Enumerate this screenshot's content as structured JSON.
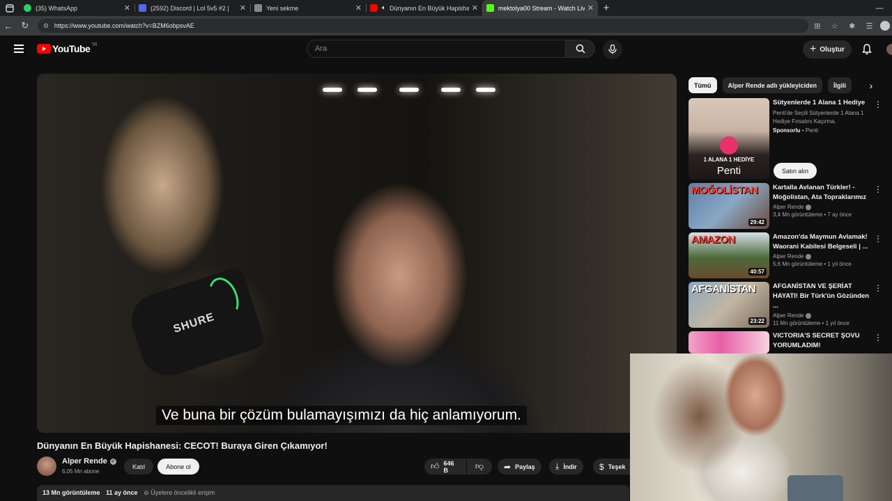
{
  "browser": {
    "tabs": [
      {
        "label": "(35) WhatsApp",
        "color": "#25d366"
      },
      {
        "label": "(2592) Discord | Lol 5v5 #2 |",
        "color": "#5865f2"
      },
      {
        "label": "Yeni sekme",
        "color": "#888888"
      },
      {
        "label": "Dünyanın En Büyük Hapisha",
        "color": "#ff0000"
      },
      {
        "label": "mektolya00 Stream - Watch Live",
        "color": "#53fc18"
      }
    ],
    "url": "https://www.youtube.com/watch?v=BZM6obpsvAE"
  },
  "header": {
    "logo": "YouTube",
    "country": "TR",
    "search_placeholder": "Ara",
    "create_label": "Oluştur"
  },
  "video": {
    "caption": "Ve buna bir çözüm bulamayışımızı da hiç anlamıyorum.",
    "mic_brand": "SHURE",
    "title": "Dünyanın En Büyük Hapishanesi: CECOT! Buraya Giren Çıkamıyor!",
    "channel": "Alper Rende",
    "subscribers": "6,05 Mn abone",
    "join_label": "Katıl",
    "subscribe_label": "Abone ol",
    "likes": "646 B",
    "share_label": "Paylaş",
    "download_label": "İndir",
    "thanks_label": "Teşek",
    "views": "13 Mn görüntüleme",
    "age": "11 ay önce",
    "members": "Üyelere öncelikli erişim"
  },
  "sidebar": {
    "chips": [
      "Tümü",
      "Alper Rende adlı yükleyiciden",
      "İlgili"
    ],
    "ad": {
      "title": "Sütyenlerde 1 Alana 1 Hediye",
      "description": "Penti'de Seçili Sütyenlerde 1 Alana 1 Hediye Fırsatını Kaçırma.",
      "sponsored": "Sponsorlu",
      "advertiser": "Penti",
      "cta": "Satın alın",
      "thumb_text1": "1 ALANA 1 HEDİYE",
      "thumb_text2": "Penti"
    },
    "videos": [
      {
        "title": "Kartalla Avlanan Türkler! - Moğolistan, Ata Topraklarımız",
        "channel": "Alper Rende",
        "stats": "3,4 Mn görüntüleme • 7 ay önce",
        "duration": "29:42",
        "thumb_word": "MOĞOLİSTAN"
      },
      {
        "title": "Amazon'da Maymun Avlamak! Waorani Kabilesi Belgeseli | ...",
        "channel": "Alper Rende",
        "stats": "5,6 Mn görüntüleme • 1 yıl önce",
        "duration": "40:57",
        "thumb_word": "AMAZON"
      },
      {
        "title": "AFGANİSTAN VE ŞERİAT HAYATI! Bir Türk'ün Gözünden ...",
        "channel": "Alper Rende",
        "stats": "11 Mn görüntüleme • 1 yıl önce",
        "duration": "23:22",
        "thumb_word": "AFGANİSTAN"
      },
      {
        "title": "VICTORIA'S SECRET ŞOVU YORUMLADIM!",
        "channel": "",
        "stats": "",
        "duration": "",
        "thumb_word": ""
      }
    ]
  }
}
